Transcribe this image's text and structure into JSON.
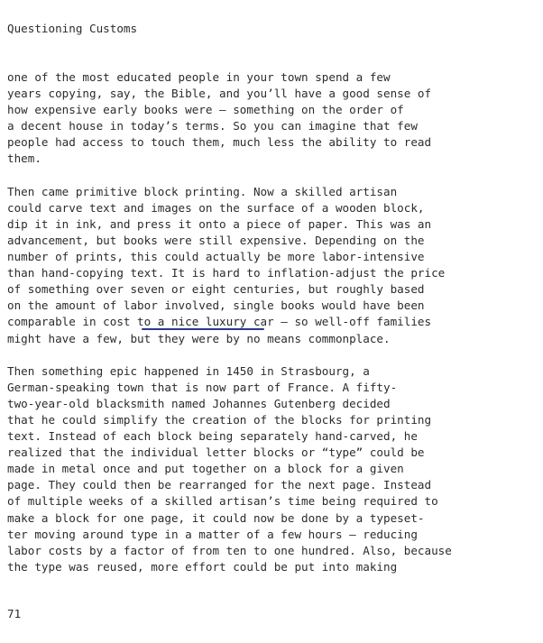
{
  "header": {
    "running_head": "Questioning Customs"
  },
  "paragraphs": [
    {
      "lines": [
        "one of the most educated people in your town spend a few",
        "years copying, say, the Bible, and you’ll have a good sense of",
        "how expensive early books were — something on the order of",
        "a decent house in today’s terms. So you can imagine that few",
        "people had access to touch them, much less the ability to read",
        "them."
      ]
    },
    {
      "lines": [
        "Then came primitive block printing. Now a skilled artisan",
        "could carve text and images on the surface of a wooden block,",
        "dip it in ink, and press it onto a piece of paper. This was an",
        "advancement, but books were still expensive. Depending on the",
        "number of prints, this could actually be more labor-intensive",
        "than hand-copying text. It is hard to inflation-adjust the price",
        "of something over seven or eight centuries, but roughly based",
        "on the amount of labor involved, single books would have been",
        "comparable in cost to a nice luxury car — so well-off families",
        "might have a few, but they were by no means commonplace."
      ]
    },
    {
      "lines": [
        "Then something epic happened in 1450 in Strasbourg, a",
        "German-speaking town that is now part of France. A fifty-",
        "two-year-old blacksmith named Johannes Gutenberg decided",
        "that he could simplify the creation of the blocks for printing",
        "text. Instead of each block being separately hand-carved, he",
        "realized that the individual letter blocks or “type” could be",
        "made in metal once and put together on a block for a given",
        "page. They could then be rearranged for the next page. Instead",
        "of multiple weeks of a skilled artisan’s time being required to",
        "make a block for one page, it could now be done by a typeset-",
        "ter moving around type in a matter of a few hours — reducing",
        "labor costs by a factor of from ten to one hundred. Also, because",
        "the type was reused, more effort could be put into making"
      ]
    }
  ],
  "footer": {
    "page_number": "71"
  },
  "colors": {
    "text": "#2b2b2b",
    "highlight_underline": "#2b3a8f"
  }
}
